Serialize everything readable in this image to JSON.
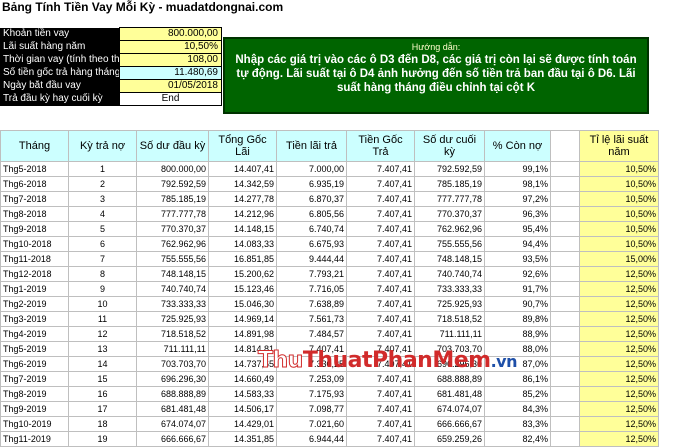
{
  "title": "Bảng Tính Tiền Vay Mỗi Kỳ - muadatdongnai.com",
  "inputs": [
    {
      "label": "Khoản tiền vay",
      "value": "800.000,00",
      "bg": "val-yellow"
    },
    {
      "label": "Lãi suất hàng năm",
      "value": "10,50%",
      "bg": "val-yellow"
    },
    {
      "label": "Thời gian vay (tính theo tháng)",
      "value": "108,00",
      "bg": "val-yellow"
    },
    {
      "label": "Số tiền gốc trả hàng tháng",
      "value": "11.480,69",
      "bg": "val-blue"
    },
    {
      "label": "Ngày bắt đầu vay",
      "value": "01/05/2018",
      "bg": "val-yellow"
    },
    {
      "label": "Trả đầu kỳ hay cuối kỳ",
      "value": "End",
      "bg": "val-white"
    }
  ],
  "note": {
    "heading": "Hướng dẫn:",
    "body": "Nhập các giá trị vào các ô D3 đến D8, các giá trị còn lại sẽ được tính toán tự động. Lãi suất tại ô D4 ảnh hưởng đến số tiền trả ban đầu tại ô D6. Lãi suất hàng tháng điều chỉnh tại cột K"
  },
  "columns": [
    "Tháng",
    "Kỳ trả nợ",
    "Số dư đầu kỳ",
    "Tổng Gốc Lãi",
    "Tiền lãi trả",
    "Tiền Gốc Trả",
    "Số dư cuối kỳ",
    "% Còn nợ",
    "",
    "Tỉ lệ lãi suất năm"
  ],
  "rows": [
    [
      "Thg5-2018",
      "1",
      "800.000,00",
      "14.407,41",
      "7.000,00",
      "7.407,41",
      "792.592,59",
      "99,1%",
      "",
      "10,50%"
    ],
    [
      "Thg6-2018",
      "2",
      "792.592,59",
      "14.342,59",
      "6.935,19",
      "7.407,41",
      "785.185,19",
      "98,1%",
      "",
      "10,50%"
    ],
    [
      "Thg7-2018",
      "3",
      "785.185,19",
      "14.277,78",
      "6.870,37",
      "7.407,41",
      "777.777,78",
      "97,2%",
      "",
      "10,50%"
    ],
    [
      "Thg8-2018",
      "4",
      "777.777,78",
      "14.212,96",
      "6.805,56",
      "7.407,41",
      "770.370,37",
      "96,3%",
      "",
      "10,50%"
    ],
    [
      "Thg9-2018",
      "5",
      "770.370,37",
      "14.148,15",
      "6.740,74",
      "7.407,41",
      "762.962,96",
      "95,4%",
      "",
      "10,50%"
    ],
    [
      "Thg10-2018",
      "6",
      "762.962,96",
      "14.083,33",
      "6.675,93",
      "7.407,41",
      "755.555,56",
      "94,4%",
      "",
      "10,50%"
    ],
    [
      "Thg11-2018",
      "7",
      "755.555,56",
      "16.851,85",
      "9.444,44",
      "7.407,41",
      "748.148,15",
      "93,5%",
      "",
      "15,00%"
    ],
    [
      "Thg12-2018",
      "8",
      "748.148,15",
      "15.200,62",
      "7.793,21",
      "7.407,41",
      "740.740,74",
      "92,6%",
      "",
      "12,50%"
    ],
    [
      "Thg1-2019",
      "9",
      "740.740,74",
      "15.123,46",
      "7.716,05",
      "7.407,41",
      "733.333,33",
      "91,7%",
      "",
      "12,50%"
    ],
    [
      "Thg2-2019",
      "10",
      "733.333,33",
      "15.046,30",
      "7.638,89",
      "7.407,41",
      "725.925,93",
      "90,7%",
      "",
      "12,50%"
    ],
    [
      "Thg3-2019",
      "11",
      "725.925,93",
      "14.969,14",
      "7.561,73",
      "7.407,41",
      "718.518,52",
      "89,8%",
      "",
      "12,50%"
    ],
    [
      "Thg4-2019",
      "12",
      "718.518,52",
      "14.891,98",
      "7.484,57",
      "7.407,41",
      "711.111,11",
      "88,9%",
      "",
      "12,50%"
    ],
    [
      "Thg5-2019",
      "13",
      "711.111,11",
      "14.814,81",
      "7.407,41",
      "7.407,41",
      "703.703,70",
      "88,0%",
      "",
      "12,50%"
    ],
    [
      "Thg6-2019",
      "14",
      "703.703,70",
      "14.737,65",
      "7.330,25",
      "7.407,41",
      "696.296,30",
      "87,0%",
      "",
      "12,50%"
    ],
    [
      "Thg7-2019",
      "15",
      "696.296,30",
      "14.660,49",
      "7.253,09",
      "7.407,41",
      "688.888,89",
      "86,1%",
      "",
      "12,50%"
    ],
    [
      "Thg8-2019",
      "16",
      "688.888,89",
      "14.583,33",
      "7.175,93",
      "7.407,41",
      "681.481,48",
      "85,2%",
      "",
      "12,50%"
    ],
    [
      "Thg9-2019",
      "17",
      "681.481,48",
      "14.506,17",
      "7.098,77",
      "7.407,41",
      "674.074,07",
      "84,3%",
      "",
      "12,50%"
    ],
    [
      "Thg10-2019",
      "18",
      "674.074,07",
      "14.429,01",
      "7.021,60",
      "7.407,41",
      "666.666,67",
      "83,3%",
      "",
      "12,50%"
    ],
    [
      "Thg11-2019",
      "19",
      "666.666,67",
      "14.351,85",
      "6.944,44",
      "7.407,41",
      "659.259,26",
      "82,4%",
      "",
      "12,50%"
    ]
  ],
  "watermark": {
    "part1": "Thu",
    "part2": "ThuatPhanMem",
    "part3": ".vn"
  },
  "colors": {
    "header_bg": "#ccffff",
    "rate_bg": "#ffff99",
    "note_bg": "#006400",
    "input_label_bg": "#000000"
  }
}
